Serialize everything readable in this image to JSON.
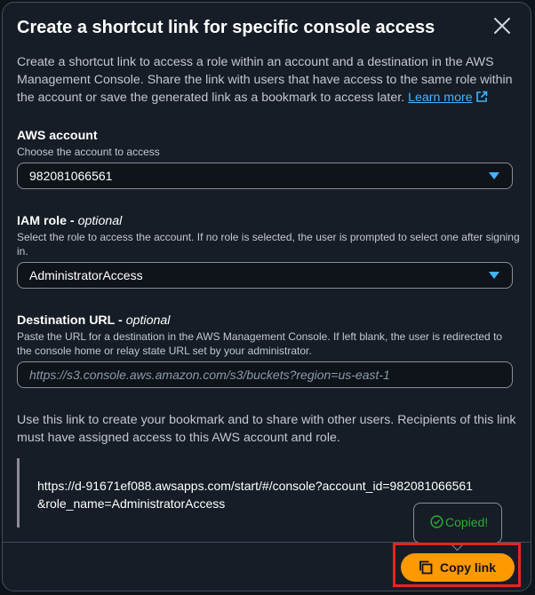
{
  "modal": {
    "title": "Create a shortcut link for specific console access",
    "description": "Create a shortcut link to access a role within an account and a destination in the AWS Management Console. Share the link with users that have access to the same role within the account or save the generated link as a bookmark to access later.",
    "learn_more": "Learn more"
  },
  "aws_account": {
    "label": "AWS account",
    "hint": "Choose the account to access",
    "value": "982081066561"
  },
  "iam_role": {
    "label": "IAM role - ",
    "optional": "optional",
    "hint": "Select the role to access the account. If no role is selected, the user is prompted to select one after signing in.",
    "value": "AdministratorAccess"
  },
  "destination_url": {
    "label": "Destination URL - ",
    "optional": "optional",
    "hint": "Paste the URL for a destination in the AWS Management Console. If left blank, the user is redirected to the console home or relay state URL set by your administrator.",
    "placeholder": "https://s3.console.aws.amazon.com/s3/buckets?region=us-east-1"
  },
  "usage_text": "Use this link to create your bookmark and to share with other users. Recipients of this link must have assigned access to this AWS account and role.",
  "generated_link": {
    "line1": "https://d-91671ef088.awsapps.com/start/#/console?account_id=982081066561",
    "line2": "&role_name=AdministratorAccess"
  },
  "popover": {
    "message": "Copied!"
  },
  "footer": {
    "copy_label": "Copy link"
  },
  "colors": {
    "accent_orange": "#ff9900",
    "link_blue": "#42b4ff",
    "success_green": "#29ad32",
    "highlight_red": "#e5261f"
  }
}
